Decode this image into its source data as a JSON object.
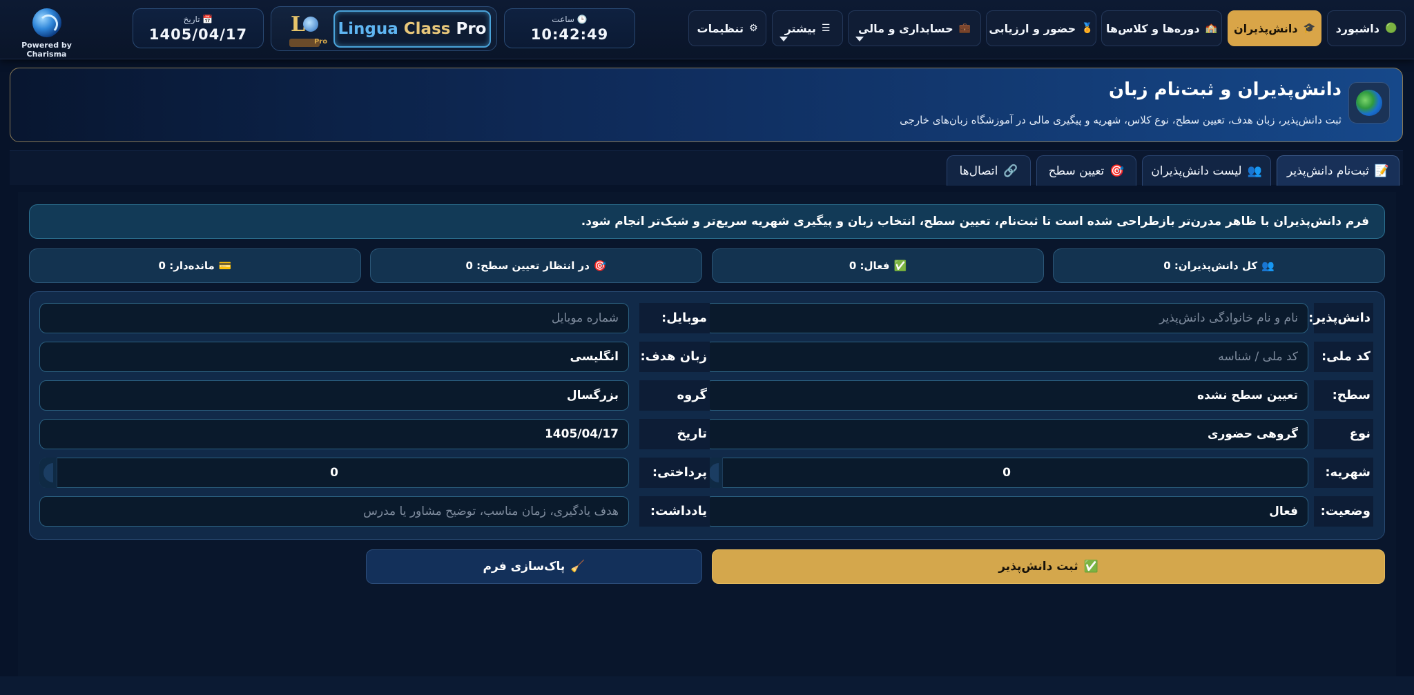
{
  "app": {
    "powered_by": "Powered by Charisma",
    "product": {
      "part1": "Lingua",
      "part2": "Class",
      "part3": "Pro"
    },
    "date": {
      "icon": "📅",
      "label": "تاریخ",
      "value": "1405/04/17"
    },
    "clock": {
      "icon": "🕒",
      "label": "ساعت",
      "value": "10:42:49"
    }
  },
  "nav": {
    "dashboard": {
      "icon": "🟢",
      "label": "داشبورد"
    },
    "students": {
      "icon": "🎓",
      "label": "دانش‌پذیران"
    },
    "courses": {
      "icon": "🏫",
      "label": "دوره‌ها و کلاس‌ها"
    },
    "attendance": {
      "icon": "🏅",
      "label": "حضور و ارزیابی"
    },
    "accounting": {
      "icon": "💼",
      "label": "حسابداری و مالی"
    },
    "more": {
      "icon": "☰",
      "label": "بیشتر"
    },
    "settings": {
      "icon": "⚙",
      "label": "تنظیمات"
    }
  },
  "header": {
    "title": "دانش‌پذیران و ثبت‌نام زبان",
    "subtitle": "ثبت دانش‌پذیر، زبان هدف، تعیین سطح، نوع کلاس، شهریه و پیگیری مالی در آموزشگاه زبان‌های خارجی"
  },
  "tabs": [
    {
      "icon": "📝",
      "label": "ثبت‌نام دانش‌پذیر"
    },
    {
      "icon": "👥",
      "label": "لیست دانش‌پذیران"
    },
    {
      "icon": "🎯",
      "label": "تعیین سطح"
    },
    {
      "icon": "🔗",
      "label": "اتصال‌ها"
    }
  ],
  "notice": "فرم دانش‌پذیران با ظاهر مدرن‌تر بازطراحی شده است تا ثبت‌نام، تعیین سطح، انتخاب زبان و پیگیری شهریه سریع‌تر و شیک‌تر انجام شود.",
  "stats": {
    "total": {
      "icon": "👥",
      "label": "کل دانش‌پذیران: 0"
    },
    "active": {
      "icon": "✅",
      "label": "فعال: 0"
    },
    "pending": {
      "icon": "🎯",
      "label": "در انتظار تعیین سطح: 0"
    },
    "balance": {
      "icon": "💳",
      "label": "مانده‌دار: 0"
    }
  },
  "form": {
    "student": {
      "label": "دانش‌پذیر:",
      "placeholder": "نام و نام خانوادگی دانش‌پذیر",
      "value": ""
    },
    "mobile": {
      "label": "موبایل:",
      "placeholder": "شماره موبایل",
      "value": ""
    },
    "national_id": {
      "label": "کد ملی:",
      "placeholder": "کد ملی / شناسه",
      "value": ""
    },
    "target_language": {
      "label": "زبان هدف:",
      "value": "انگلیسی"
    },
    "level": {
      "label": "سطح:",
      "value": "تعیین سطح نشده"
    },
    "age_group": {
      "label": "گروه سنی:",
      "value": "بزرگسال"
    },
    "class_type": {
      "label": "نوع کلاس:",
      "value": "گروهی حضوری"
    },
    "registration_date": {
      "label": "تاریخ ثبت‌نام:",
      "value": "1405/04/17"
    },
    "tuition": {
      "label": "شهریه:",
      "value": "0"
    },
    "paid": {
      "label": "پرداختی:",
      "value": "0"
    },
    "status": {
      "label": "وضعیت:",
      "value": "فعال"
    },
    "note": {
      "label": "یادداشت:",
      "placeholder": "هدف یادگیری، زمان مناسب، توضیح مشاور یا مدرس",
      "value": ""
    }
  },
  "actions": {
    "save": {
      "icon": "✅",
      "label": "ثبت دانش‌پذیر"
    },
    "clear": {
      "icon": "🧹",
      "label": "پاک‌سازی فرم"
    }
  },
  "colors": {
    "accent": "#d9a548",
    "background": "#071329",
    "panel": "#112a49",
    "notice": "#123a57"
  }
}
